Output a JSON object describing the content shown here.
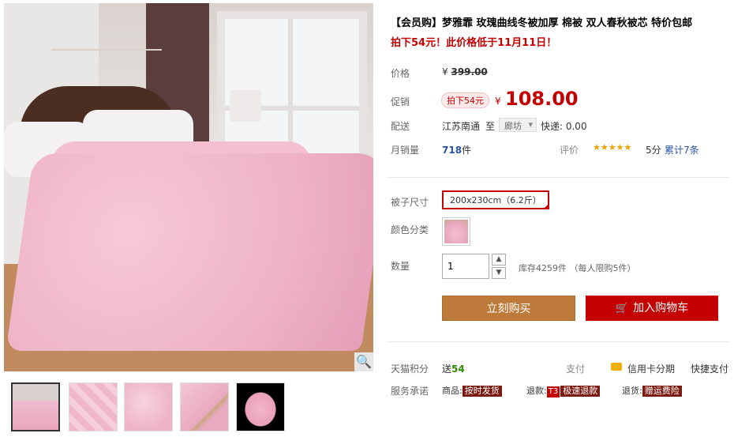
{
  "product": {
    "title": "【会员购】梦雅霏 玫瑰曲线冬被加厚 棉被 双人春秋被芯 特价包邮",
    "subtitle": "拍下54元！此价格低于11月11日！"
  },
  "price": {
    "label": "价格",
    "original_currency": "¥",
    "original": "399.00",
    "promo_label": "促销",
    "promo_badge": "拍下54元",
    "currency": "¥",
    "current": "108.00"
  },
  "shipping": {
    "label": "配送",
    "from": "江苏南通",
    "to_word": "至",
    "destination": "廊坊",
    "freight": "快递: 0.00"
  },
  "sales": {
    "label": "月销量",
    "count": "718",
    "unit": "件",
    "rating_label": "评价",
    "stars": "★★★★★",
    "score": "5分",
    "reviews": "累计7条"
  },
  "options": {
    "size_label": "被子尺寸",
    "size_value": "200x230cm（6.2斤）",
    "color_label": "颜色分类"
  },
  "quantity": {
    "label": "数量",
    "value": "1",
    "up_icon": "▲",
    "down_icon": "▼",
    "stock": "库存4259件 （每人限购5件）"
  },
  "actions": {
    "buy_now": "立刻购买",
    "cart_icon": "🛒",
    "add_to_cart": "加入购物车"
  },
  "points": {
    "label": "天猫积分",
    "give_word": "送",
    "value": "54",
    "pay_label": "支付",
    "credit_installment": "信用卡分期",
    "quick_pay": "快捷支付"
  },
  "promise": {
    "label": "服务承诺",
    "goods_prefix": "商品:",
    "goods_tag": "按时发货",
    "refund_prefix": "退款:",
    "refund_t3": "T3",
    "refund_tag": "极速退款",
    "return_prefix": "退货:",
    "return_tag": "赠运费险"
  },
  "gallery": {
    "zoom_icon": "🔍",
    "thumb_count": 5
  },
  "colors": {
    "accent_red": "#c40000",
    "buy_button": "#bd7a3a",
    "link_blue": "#2953a6",
    "points_green": "#2d8c00"
  }
}
